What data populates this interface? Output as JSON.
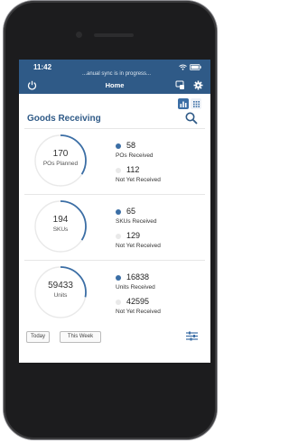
{
  "status_bar": {
    "time": "11:42",
    "sync_text": "...anual sync is in progress..."
  },
  "navbar": {
    "title": "Home"
  },
  "page": {
    "title": "Goods Receiving"
  },
  "colors": {
    "accent": "#2f5a87",
    "ring": "#3b6ea5",
    "track": "#e9e9e9"
  },
  "cards": [
    {
      "total": "170",
      "total_label": "POs Planned",
      "received": "58",
      "received_label": "POs Received",
      "pending": "112",
      "pending_label": "Not Yet Received",
      "fraction": 0.34
    },
    {
      "total": "194",
      "total_label": "SKUs",
      "received": "65",
      "received_label": "SKUs Received",
      "pending": "129",
      "pending_label": "Not Yet Received",
      "fraction": 0.34
    },
    {
      "total": "59433",
      "total_label": "Units",
      "received": "16838",
      "received_label": "Units Received",
      "pending": "42595",
      "pending_label": "Not Yet Received",
      "fraction": 0.28
    }
  ],
  "filters": {
    "today": "Today",
    "this_week": "This Week"
  }
}
